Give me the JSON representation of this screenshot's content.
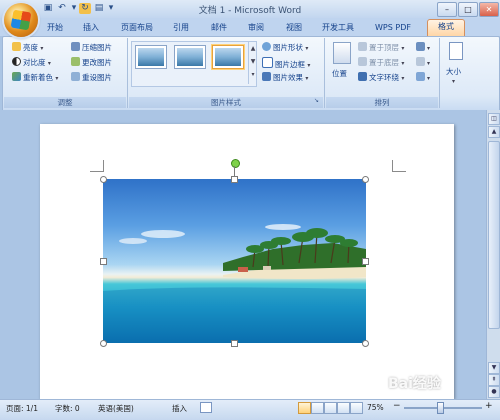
{
  "app": {
    "title": "文档 1 - Microsoft Word"
  },
  "window": {
    "minimize": "–",
    "maximize": "□",
    "close": "✕"
  },
  "tabs": [
    "开始",
    "插入",
    "页面布局",
    "引用",
    "邮件",
    "审阅",
    "视图",
    "开发工具",
    "WPS PDF",
    "格式"
  ],
  "ribbon": {
    "adjust": {
      "label": "调整",
      "left": [
        "亮度",
        "对比度",
        "重新着色"
      ],
      "right": [
        "压缩图片",
        "更改图片",
        "重设图片"
      ]
    },
    "styles": {
      "label": "图片样式",
      "buttons": [
        "图片形状",
        "图片边框",
        "图片效果"
      ]
    },
    "arrange": {
      "label": "排列",
      "position": "位置",
      "buttons": [
        "置于顶层",
        "置于底层",
        "文字环绕"
      ]
    },
    "size": {
      "label": "大小"
    }
  },
  "status": {
    "page": "页面: 1/1",
    "words": "字数: 0",
    "language": "英语(美国)",
    "mode": "插入",
    "zoom": "75%",
    "zoom_out": "−",
    "zoom_in": "+"
  },
  "watermark": "Bai经验",
  "colors": {
    "accent_tab": "#ffd6a6",
    "ribbon_bg": "#dde9f7",
    "workspace": "#abc5e4"
  },
  "icons": [
    "office-button-icon",
    "save-icon",
    "undo-icon",
    "redo-icon",
    "rotate-handle-icon"
  ]
}
